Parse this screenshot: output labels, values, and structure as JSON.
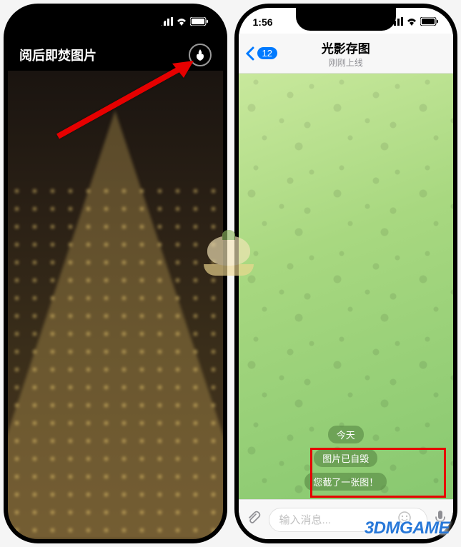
{
  "left": {
    "title": "阅后即焚图片",
    "self_destruct_icon": "fire-icon"
  },
  "right": {
    "status_time": "1:56",
    "back_unread_count": "12",
    "chat_title": "光影存图",
    "chat_subtitle": "刚刚上线",
    "date_label": "今天",
    "system_msg_1": "图片已自毁",
    "system_msg_2": "您截了一张图！",
    "input_placeholder": "输入消息..."
  },
  "watermark_text": "3DMGAME",
  "colors": {
    "accent_blue": "#007aff",
    "highlight_red": "#e60000",
    "chat_bg_start": "#c8e89c",
    "chat_bg_end": "#88c870"
  }
}
